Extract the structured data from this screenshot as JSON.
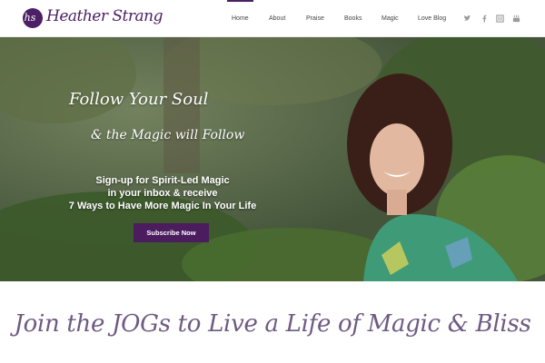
{
  "header": {
    "logo_monogram": "hs",
    "logo_text": "Heather Strang",
    "nav": [
      "Home",
      "About",
      "Praise",
      "Books",
      "Magic",
      "Love Blog"
    ],
    "active_nav": "Home",
    "social_icons": [
      "twitter-icon",
      "facebook-icon",
      "goodreads-icon",
      "youtube-icon"
    ]
  },
  "hero": {
    "headline_line1": "Follow Your Soul",
    "headline_line2": "& the Magic will Follow",
    "signup_line1": "Sign-up for Spirit-Led Magic",
    "signup_line2": "in your inbox & receive",
    "signup_line3": "7 Ways to Have More Magic In Your Life",
    "cta_label": "Subscribe Now"
  },
  "tagline": "Join the JOGs to Live a Life of Magic & Bliss",
  "colors": {
    "brand_purple": "#4b2064",
    "nav_text": "#444444",
    "tagline": "#6f5a82"
  }
}
